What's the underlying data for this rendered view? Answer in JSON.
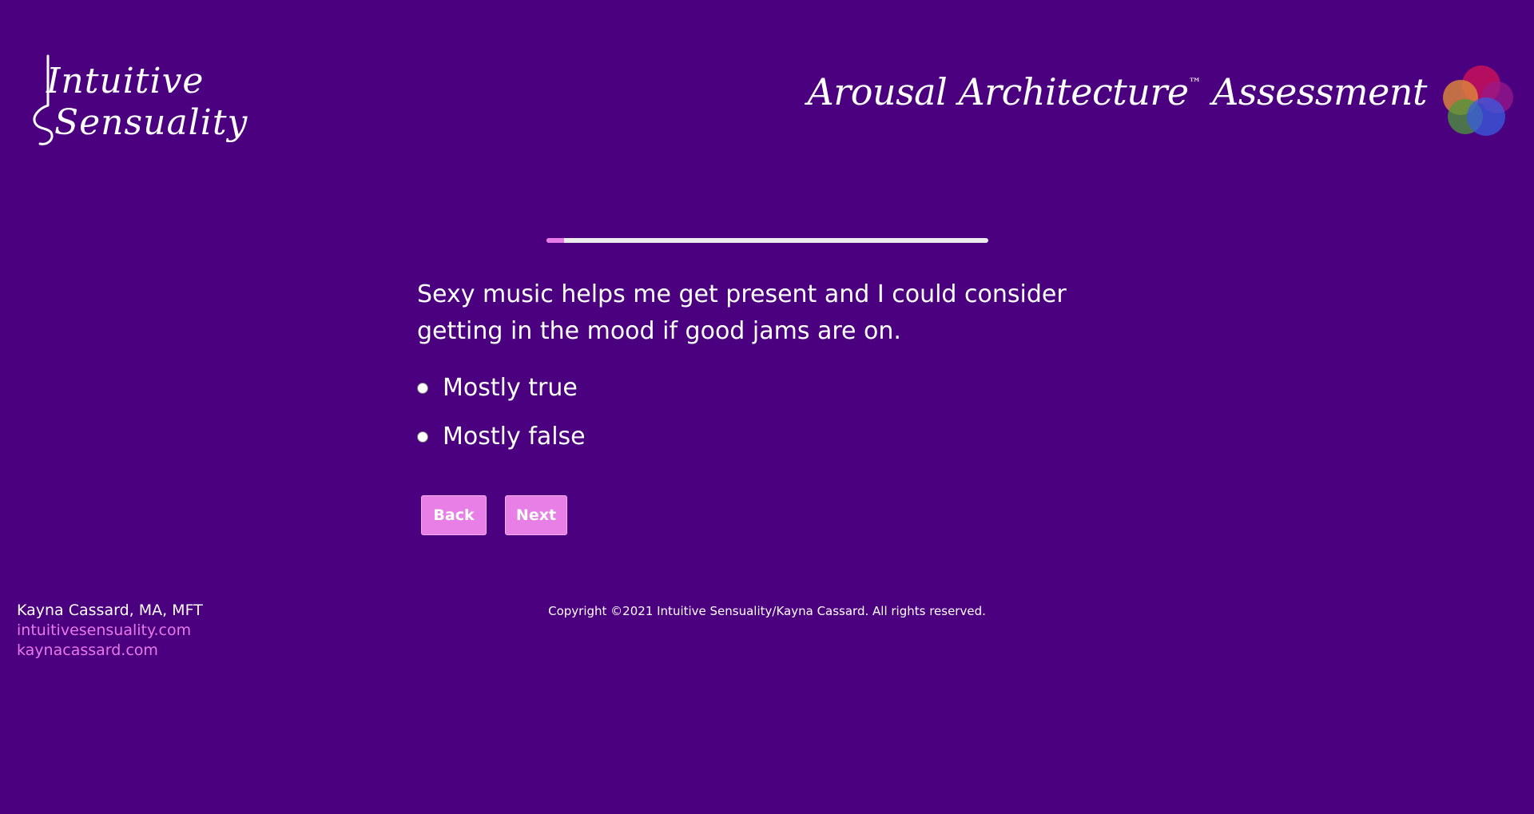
{
  "header": {
    "logo_line1": "Intuitive",
    "logo_line2": "Sensuality",
    "assessment_title": "Arousal Architecture",
    "trademark": "™",
    "assessment_word": "Assessment"
  },
  "progress": {
    "fraction": 0.04
  },
  "question": {
    "text": "Sexy music helps me get present and I could consider getting in the mood if good jams are on.",
    "options": [
      {
        "label": "Mostly true",
        "selected": false
      },
      {
        "label": "Mostly false",
        "selected": false
      }
    ]
  },
  "buttons": {
    "back_label": "Back",
    "next_label": "Next"
  },
  "footer": {
    "name": "Kayna Cassard, MA, MFT",
    "link1": "intuitivesensuality.com",
    "link2": "kaynacassard.com",
    "copyright": "Copyright ©2021 Intuitive Sensuality/Kayna Cassard. All rights reserved."
  },
  "colors": {
    "background": "#4a007f",
    "accent": "#e879e8",
    "button": "#e87fe6",
    "track": "#ececec"
  }
}
